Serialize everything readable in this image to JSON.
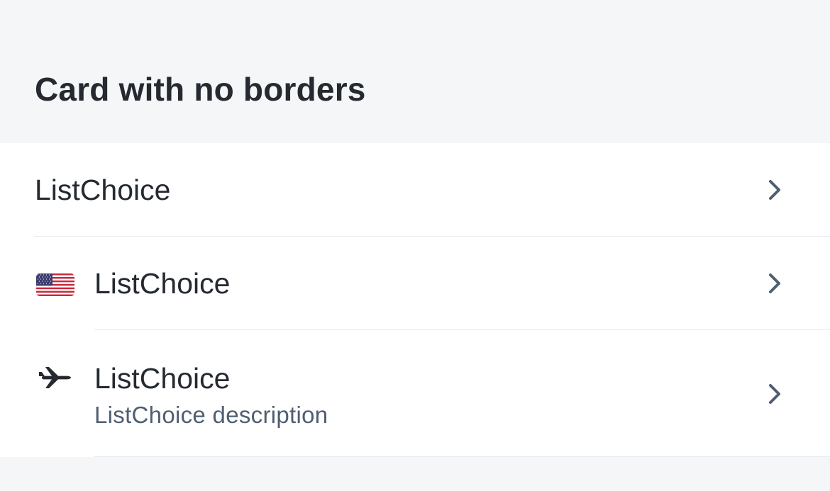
{
  "section": {
    "title": "Card with no borders"
  },
  "card": {
    "items": [
      {
        "title": "ListChoice",
        "icon": "chevron-right-icon"
      },
      {
        "title": "ListChoice",
        "leading_icon": "us-flag-icon",
        "icon": "chevron-right-icon"
      },
      {
        "title": "ListChoice",
        "description": "ListChoice description",
        "leading_icon": "airplane-icon",
        "icon": "chevron-right-icon"
      }
    ]
  },
  "colors": {
    "background": "#f5f6f8",
    "card": "#ffffff",
    "text_primary": "#252a31",
    "text_secondary": "#4f5e71",
    "chevron": "#4f5e71",
    "divider": "#e8edf1"
  }
}
